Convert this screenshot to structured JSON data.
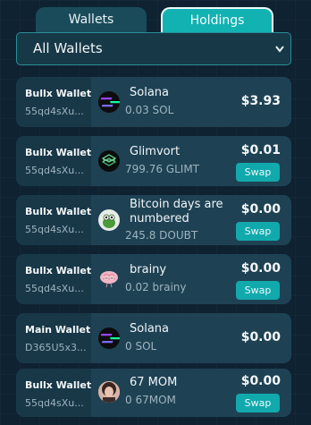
{
  "tabs": {
    "wallets_label": "Wallets",
    "holdings_label": "Holdings",
    "active": "Holdings"
  },
  "wallet_select": {
    "value": "All Wallets"
  },
  "holdings": [
    {
      "wallet": "Bullx Wallet",
      "address": "55qd4sXu...",
      "token": "Solana",
      "token_line2": "",
      "amount": "0.03 SOL",
      "value": "$3.93",
      "swap": "",
      "icon": "solana-icon"
    },
    {
      "wallet": "Bullx Wallet",
      "address": "55qd4sXu...",
      "token": "Glimvort",
      "token_line2": "",
      "amount": "799.76 GLIMT",
      "value": "$0.01",
      "swap": "Swap",
      "icon": "glimvort-icon"
    },
    {
      "wallet": "Bullx Wallet",
      "address": "55qd4sXu...",
      "token": "Bitcoin days are",
      "token_line2": "numbered",
      "amount": "245.8 DOUBT",
      "value": "$0.00",
      "swap": "Swap",
      "icon": "doubt-frog-icon"
    },
    {
      "wallet": "Bullx Wallet",
      "address": "55qd4sXu...",
      "token": "brainy",
      "token_line2": "",
      "amount": "0.02 brainy",
      "value": "$0.00",
      "swap": "Swap",
      "icon": "brainy-brain-icon"
    },
    {
      "wallet": "Main Wallet",
      "address": "D365U5x3...",
      "token": "Solana",
      "token_line2": "",
      "amount": "0 SOL",
      "value": "$0.00",
      "swap": "",
      "icon": "solana-icon"
    },
    {
      "wallet": "Bullx Wallet",
      "address": "55qd4sXu...",
      "token": "67 MOM",
      "token_line2": "",
      "amount": "0 67MOM",
      "value": "$0.00",
      "swap": "Swap",
      "icon": "67mom-avatar-icon"
    }
  ],
  "colors": {
    "background": "#0f2232",
    "card": "#1e4254",
    "accent": "#12a9ad",
    "muted_text": "#9fb3be"
  }
}
